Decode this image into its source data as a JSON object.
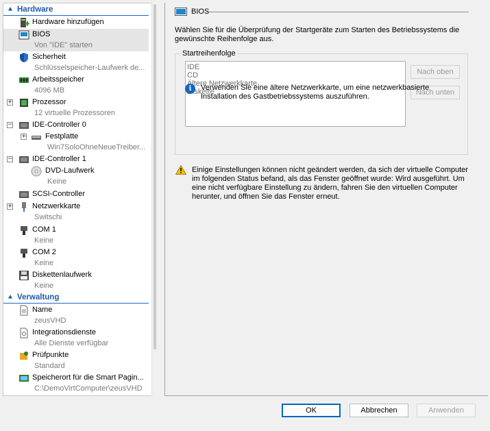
{
  "tree": {
    "hardware_header": "Hardware",
    "management_header": "Verwaltung",
    "items": [
      {
        "label": "Hardware hinzufügen",
        "sub": ""
      },
      {
        "label": "BIOS",
        "sub": "Von \"IDE\" starten"
      },
      {
        "label": "Sicherheit",
        "sub": "Schlüsselspeicher-Laufwerk de..."
      },
      {
        "label": "Arbeitsspeicher",
        "sub": "4096 MB"
      },
      {
        "label": "Prozessor",
        "sub": "12 virtuelle Prozessoren"
      },
      {
        "label": "IDE-Controller 0",
        "sub": ""
      },
      {
        "label": "Festplatte",
        "sub": "Win7SoloOhneNeueTreiber..."
      },
      {
        "label": "IDE-Controller 1",
        "sub": ""
      },
      {
        "label": "DVD-Laufwerk",
        "sub": "Keine"
      },
      {
        "label": "SCSI-Controller",
        "sub": ""
      },
      {
        "label": "Netzwerkkarte",
        "sub": "Switschi"
      },
      {
        "label": "COM 1",
        "sub": "Keine"
      },
      {
        "label": "COM 2",
        "sub": "Keine"
      },
      {
        "label": "Diskettenlaufwerk",
        "sub": "Keine"
      },
      {
        "label": "Name",
        "sub": "zeusVHD"
      },
      {
        "label": "Integrationsdienste",
        "sub": "Alle Dienste verfügbar"
      },
      {
        "label": "Prüfpunkte",
        "sub": "Standard"
      },
      {
        "label": "Speicherort für die Smart Pagin...",
        "sub": "C:\\DemoVirtComputer\\zeusVHD"
      }
    ]
  },
  "panel": {
    "title": "BIOS",
    "description": "Wählen Sie für die Überprüfung der Startgeräte zum Starten des Betriebssystems die gewünschte Reihenfolge aus.",
    "group_label": "Startreihenfolge",
    "boot_order": [
      "IDE",
      "CD",
      "Ältere Netzwerkkarte",
      "Diskette"
    ],
    "move_up": "Nach oben",
    "move_down": "Nach unten",
    "info": "Verwenden Sie eine ältere Netzwerkkarte, um eine netzwerkbasierte Installation des Gastbetriebssystems auszuführen.",
    "warning": "Einige Einstellungen können nicht geändert werden, da sich der virtuelle Computer im folgenden Status befand, als das Fenster geöffnet wurde: Wird ausgeführt. Um eine nicht verfügbare Einstellung zu ändern, fahren Sie den virtuellen Computer herunter, und öffnen Sie das Fenster erneut."
  },
  "buttons": {
    "ok": "OK",
    "cancel": "Abbrechen",
    "apply": "Anwenden"
  },
  "colors": {
    "accent": "#1f5aa8",
    "selection": "#e5e5e5",
    "info_blue": "#1565c0",
    "warning_yellow": "#f2c200"
  },
  "icons": [
    "chevron-up-icon",
    "add-hardware-icon",
    "bios-chip-icon",
    "shield-icon",
    "memory-icon",
    "processor-icon",
    "ide-controller-icon",
    "hard-disk-icon",
    "dvd-disc-icon",
    "scsi-controller-icon",
    "network-adapter-icon",
    "serial-port-icon",
    "floppy-icon",
    "name-document-icon",
    "integration-services-icon",
    "checkpoint-icon",
    "smart-paging-icon",
    "monitor-icon",
    "info-icon",
    "warning-icon"
  ]
}
